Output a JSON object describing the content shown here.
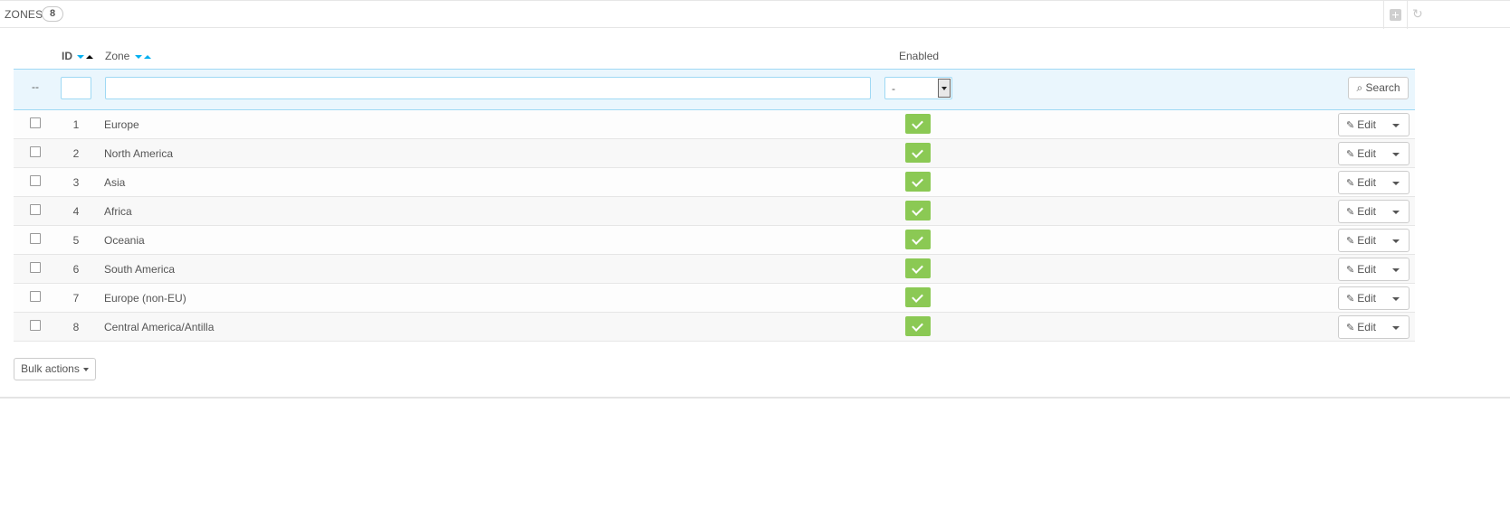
{
  "panel": {
    "title": "ZONES",
    "count": "8"
  },
  "table": {
    "headers": {
      "id": "ID",
      "zone": "Zone",
      "enabled": "Enabled"
    },
    "filter": {
      "dash": "--",
      "id_value": "",
      "zone_value": "",
      "enabled_value": "-",
      "search_label": "Search"
    },
    "rows": [
      {
        "id": "1",
        "zone": "Europe",
        "enabled": true
      },
      {
        "id": "2",
        "zone": "North America",
        "enabled": true
      },
      {
        "id": "3",
        "zone": "Asia",
        "enabled": true
      },
      {
        "id": "4",
        "zone": "Africa",
        "enabled": true
      },
      {
        "id": "5",
        "zone": "Oceania",
        "enabled": true
      },
      {
        "id": "6",
        "zone": "South America",
        "enabled": true
      },
      {
        "id": "7",
        "zone": "Europe (non-EU)",
        "enabled": true
      },
      {
        "id": "8",
        "zone": "Central America/Antilla",
        "enabled": true
      }
    ],
    "edit_label": "Edit"
  },
  "bulk_actions_label": "Bulk actions",
  "colors": {
    "accent": "#00aff0",
    "enabled_green": "#8bc954",
    "filter_bg": "#eaf6fd"
  }
}
